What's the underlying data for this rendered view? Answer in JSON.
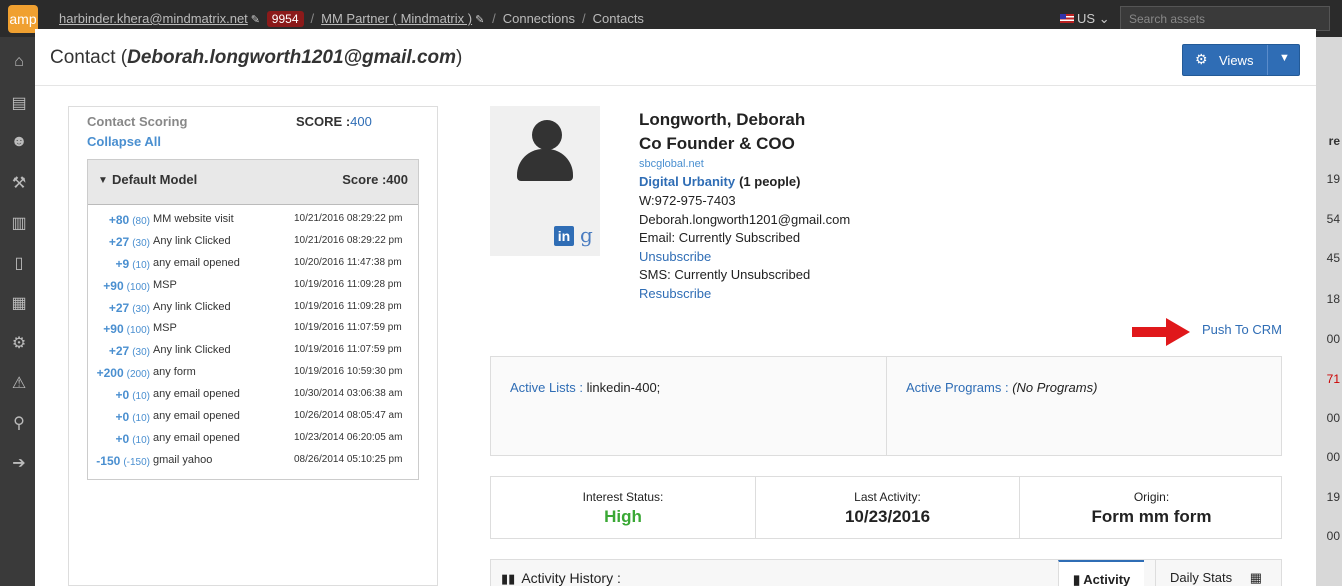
{
  "topbar": {
    "logo": "amp",
    "user_email": "harbinder.khera@mindmatrix.net",
    "badge_count": "9954",
    "partner": "MM Partner ( Mindmatrix )",
    "crumb_connections": "Connections",
    "crumb_contacts": "Contacts",
    "locale": "US",
    "search_placeholder": "Search assets"
  },
  "right_column": {
    "header": "re",
    "values": [
      "19",
      "54",
      "45",
      "18",
      "00",
      "71",
      "00",
      "00",
      "19",
      "00"
    ]
  },
  "modal": {
    "title_prefix": "Contact (",
    "title_email": "Deborah.longworth1201@gmail.com",
    "title_suffix": ")",
    "views_label": "Views"
  },
  "scoring": {
    "title": "Contact Scoring",
    "score_label": "SCORE :",
    "score_value": "400",
    "collapse_all": "Collapse All",
    "model_name": "Default Model",
    "model_score": "Score :400",
    "rows": [
      {
        "points": "+80",
        "base": "(80)",
        "activity": "MM website visit",
        "date": "10/21/2016 08:29:22 pm"
      },
      {
        "points": "+27",
        "base": "(30)",
        "activity": "Any link Clicked",
        "date": "10/21/2016 08:29:22 pm"
      },
      {
        "points": "+9",
        "base": "(10)",
        "activity": "any email opened",
        "date": "10/20/2016 11:47:38 pm"
      },
      {
        "points": "+90",
        "base": "(100)",
        "activity": "MSP",
        "date": "10/19/2016 11:09:28 pm"
      },
      {
        "points": "+27",
        "base": "(30)",
        "activity": "Any link Clicked",
        "date": "10/19/2016 11:09:28 pm"
      },
      {
        "points": "+90",
        "base": "(100)",
        "activity": "MSP",
        "date": "10/19/2016 11:07:59 pm"
      },
      {
        "points": "+27",
        "base": "(30)",
        "activity": "Any link Clicked",
        "date": "10/19/2016 11:07:59 pm"
      },
      {
        "points": "+200",
        "base": "(200)",
        "activity": "any form",
        "date": "10/19/2016 10:59:30 pm"
      },
      {
        "points": "+0",
        "base": "(10)",
        "activity": "any email opened",
        "date": "10/30/2014 03:06:38 am"
      },
      {
        "points": "+0",
        "base": "(10)",
        "activity": "any email opened",
        "date": "10/26/2014 08:05:47 am"
      },
      {
        "points": "+0",
        "base": "(10)",
        "activity": "any email opened",
        "date": "10/23/2014 06:20:05 am"
      },
      {
        "points": "-150",
        "base": "(-150)",
        "activity": "gmail yahoo",
        "date": "08/26/2014 05:10:25 pm"
      }
    ]
  },
  "profile": {
    "name": "Longworth, Deborah",
    "job_title": "Co Founder & COO",
    "domain": "sbcglobal.net",
    "company": "Digital Urbanity",
    "company_count": "(1 people)",
    "work_phone": "W:972-975-7403",
    "email": "Deborah.longworth1201@gmail.com",
    "email_status": "Email: Currently Subscribed",
    "unsubscribe": "Unsubscribe",
    "sms_status": "SMS: Currently Unsubscribed",
    "resubscribe": "Resubscribe",
    "push_to_crm": "Push To CRM"
  },
  "lists": {
    "active_lists_label": "Active Lists :",
    "active_lists_value": " linkedin-400;",
    "active_programs_label": "Active Programs :",
    "active_programs_value": " (No Programs)"
  },
  "stats": {
    "interest_label": "Interest Status:",
    "interest_value": "High",
    "last_activity_label": "Last Activity:",
    "last_activity_value": "10/23/2016",
    "origin_label": "Origin:",
    "origin_value": "Form mm form"
  },
  "history": {
    "title": "Activity History :",
    "tab_activity": "Activity",
    "tab_daily": "Daily Stats"
  },
  "colors": {
    "accent": "#2f6db5",
    "link": "#4a8fd0",
    "high_status": "#3aa835",
    "arrow": "#e0181b"
  }
}
